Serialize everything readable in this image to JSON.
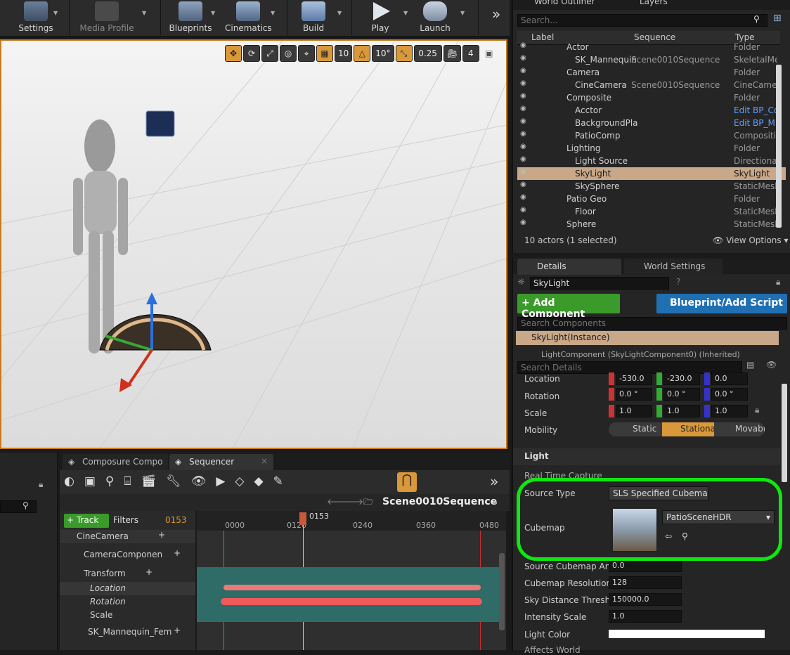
{
  "toolbar": {
    "items": [
      {
        "label": "Settings"
      },
      {
        "label": "Media Profile"
      },
      {
        "label": "Blueprints"
      },
      {
        "label": "Cinematics"
      },
      {
        "label": "Build"
      },
      {
        "label": "Play"
      },
      {
        "label": "Launch"
      }
    ],
    "overflow": "»"
  },
  "viewport": {
    "grid_snap": "10",
    "rotate_snap": "10°",
    "scale_snap": "0.25",
    "camera_speed": "4"
  },
  "outliner": {
    "tabs": [
      "World Outliner",
      "Layers"
    ],
    "search_placeholder": "Search...",
    "columns": [
      "Label",
      "Sequence",
      "Type"
    ],
    "rows": [
      {
        "label": "Actor",
        "sequence": "",
        "type": "Folder"
      },
      {
        "label": "SK_Mannequin",
        "sequence": "Scene0010Sequence",
        "type": "SkeletalMe"
      },
      {
        "label": "Camera",
        "sequence": "",
        "type": "Folder"
      },
      {
        "label": "CineCamera",
        "sequence": "Scene0010Sequence",
        "type": "CineCamer"
      },
      {
        "label": "Composite",
        "sequence": "",
        "type": "Folder"
      },
      {
        "label": "Acctor",
        "sequence": "",
        "type": "Edit BP_Co"
      },
      {
        "label": "BackgroundPla",
        "sequence": "",
        "type": "Edit BP_M"
      },
      {
        "label": "PatioComp",
        "sequence": "",
        "type": "Compositir"
      },
      {
        "label": "Lighting",
        "sequence": "",
        "type": "Folder"
      },
      {
        "label": "Light Source",
        "sequence": "",
        "type": "Directional"
      },
      {
        "label": "SkyLight",
        "sequence": "",
        "type": "SkyLight"
      },
      {
        "label": "SkySphere",
        "sequence": "",
        "type": "StaticMesh"
      },
      {
        "label": "Patio Geo",
        "sequence": "",
        "type": "Folder"
      },
      {
        "label": "Floor",
        "sequence": "",
        "type": "StaticMesh"
      },
      {
        "label": "Sphere",
        "sequence": "",
        "type": "StaticMesh"
      }
    ],
    "status": "10 actors (1 selected)",
    "view_options": "View Options"
  },
  "details": {
    "tabs": [
      "Details",
      "World Settings"
    ],
    "actor_name": "SkyLight",
    "add_component": "+ Add Component",
    "blueprint_script": "Blueprint/Add Script",
    "search_components_placeholder": "Search Components",
    "instance_label": "SkyLight(Instance)",
    "light_component": "LightComponent (SkyLightComponent0) (Inherited)",
    "search_details_placeholder": "Search Details",
    "transform": {
      "location_label": "Location",
      "location": [
        "-530.0",
        "-230.0",
        "0.0"
      ],
      "rotation_label": "Rotation",
      "rotation": [
        "0.0 °",
        "0.0 °",
        "0.0 °"
      ],
      "scale_label": "Scale",
      "scale": [
        "1.0",
        "1.0",
        "1.0"
      ]
    },
    "mobility_label": "Mobility",
    "mobility_options": [
      "Static",
      "Stationa",
      "Movabl"
    ],
    "light_section": "Light",
    "real_time_capture": "Real Time Capture",
    "source_type_label": "Source Type",
    "source_type_value": "SLS Specified Cubemap",
    "cubemap_label": "Cubemap",
    "cubemap_asset": "PatioSceneHDR",
    "props": [
      {
        "label": "Source Cubemap Angle",
        "value": "0.0"
      },
      {
        "label": "Cubemap Resolution",
        "value": "128"
      },
      {
        "label": "Sky Distance Threshold",
        "value": "150000.0"
      },
      {
        "label": "Intensity Scale",
        "value": "1.0"
      }
    ],
    "light_color": "Light Color",
    "affects_world": "Affects World"
  },
  "sequencer": {
    "tabs": [
      "Composure Compo",
      "Sequencer"
    ],
    "sequence_name": "Scene0010Sequence",
    "track_button": "+ Track",
    "filters_button": "Filters",
    "search_frame": "0153",
    "current_frame": "0153",
    "ticks": [
      "0000",
      "0120",
      "0240",
      "0360",
      "0480"
    ],
    "tree": [
      {
        "label": "CineCamera"
      },
      {
        "label": "CameraComponen"
      },
      {
        "label": "Transform"
      },
      {
        "label": "Location"
      },
      {
        "label": "Rotation"
      },
      {
        "label": "Scale"
      },
      {
        "label": "SK_Mannequin_Fem"
      }
    ]
  },
  "colors": {
    "selection": "#c8a888",
    "accent_orange": "#d9983a",
    "highlight_green": "#11e611",
    "add_component_green": "#3a9a2a",
    "blueprint_blue": "#1f6fb3"
  }
}
